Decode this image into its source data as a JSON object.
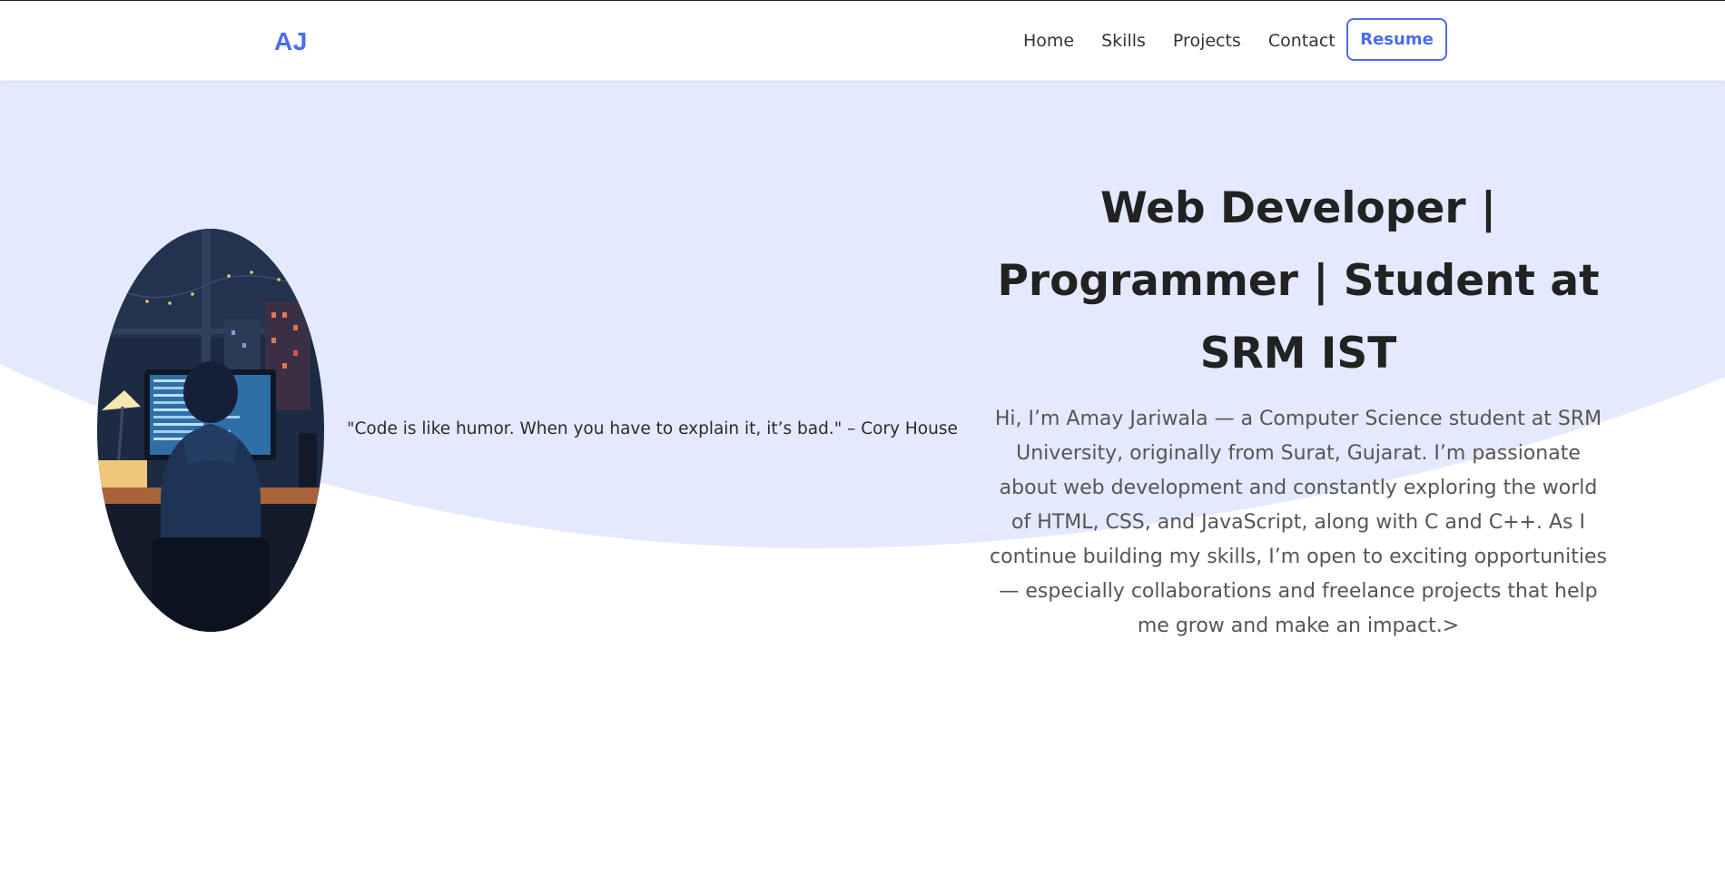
{
  "nav": {
    "logo": "AJ",
    "links": [
      "Home",
      "Skills",
      "Projects",
      "Contact"
    ],
    "resume_label": "Resume"
  },
  "hero": {
    "quote": "\"Code is like humor. When you have to explain it, it’s bad.\" – Cory House",
    "title": "Web Developer | Programmer | Student at SRM IST",
    "description": "Hi, I’m Amay Jariwala — a Computer Science student at SRM University, originally from Surat, Gujarat. I’m passionate about web development and constantly exploring the world of HTML, CSS, and JavaScript, along with C and C++. As I continue building my skills, I’m open to exciting opportunities — especially collaborations and freelance projects that help me grow and make an impact.>"
  },
  "colors": {
    "accent": "#4a6cf0",
    "hero_background": "#e4e9fd",
    "title_text": "#222222",
    "body_text": "#555555"
  },
  "icons": {
    "hero_image": "developer-at-desk-illustration"
  }
}
